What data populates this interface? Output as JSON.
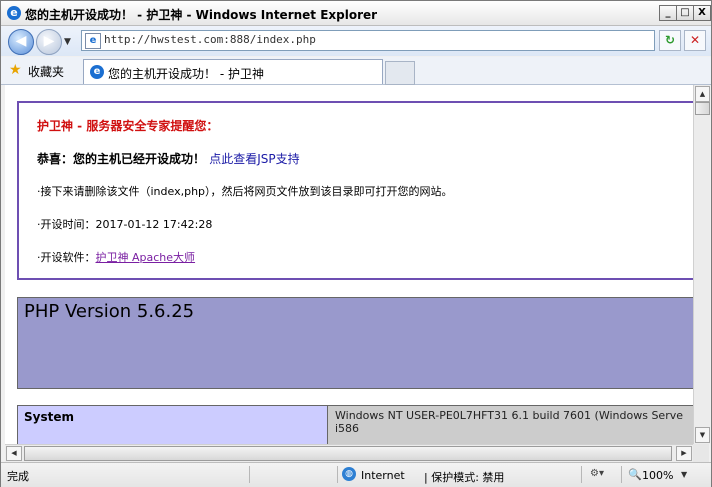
{
  "window": {
    "title": "您的主机开设成功！ - 护卫神 - Windows Internet Explorer",
    "minimize": "_",
    "maximize": "□",
    "close": "X"
  },
  "address_bar": {
    "url": "http://hwstest.com:888/index.php",
    "back_icon": "back-arrow-icon",
    "forward_icon": "forward-arrow-icon"
  },
  "favorites": {
    "label": "收藏夹"
  },
  "tabs": [
    {
      "label": "您的主机开设成功！ - 护卫神"
    }
  ],
  "page": {
    "notice": {
      "title": "护卫神 - 服务器安全专家提醒您：",
      "congrats": "恭喜：您的主机已经开设成功！",
      "jsp_link": "点此查看JSP支持",
      "next_step": "·接下来请删除该文件（index,php），然后将网页文件放到该目录即可打开您的网站。",
      "time_label": "·开设时间：",
      "time_value": "2017-01-12 17:42:28",
      "software_label": "·开设软件：",
      "software_link": "护卫神 Apache大师"
    },
    "php": {
      "version_title": "PHP Version 5.6.25"
    },
    "system_table": {
      "label": "System",
      "value_line1": "Windows NT USER-PE0L7HFT31 6.1 build 7601 (Windows Serve",
      "value_line2": "i586"
    }
  },
  "status_bar": {
    "done": "完成",
    "zone": "Internet",
    "protected_mode": "| 保护模式: 禁用",
    "zoom": "100%"
  },
  "colors": {
    "notice_border": "#6d4fb2",
    "notice_title": "#d01010",
    "php_header_bg": "#9999cc",
    "table_label_bg": "#ccccff",
    "table_value_bg": "#cccccc"
  }
}
